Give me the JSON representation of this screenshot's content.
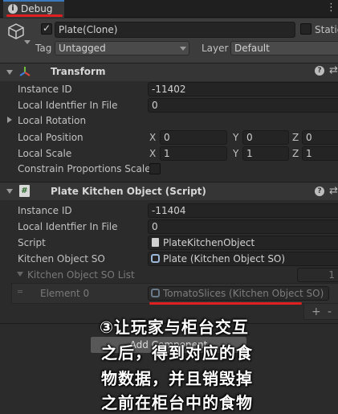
{
  "tab": {
    "label": "Debug"
  },
  "object": {
    "name": "Plate(Clone)",
    "static_label": "Static",
    "tag_label": "Tag",
    "tag_value": "Untagged",
    "layer_label": "Layer",
    "layer_value": "Default"
  },
  "transform": {
    "title": "Transform",
    "instance_id_label": "Instance ID",
    "instance_id": "-11402",
    "local_id_label": "Local Identfier In File",
    "local_id": "0",
    "rotation_label": "Local Rotation",
    "position_label": "Local Position",
    "position": {
      "x": "0",
      "y": "0",
      "z": "0"
    },
    "scale_label": "Local Scale",
    "scale": {
      "x": "1",
      "y": "1",
      "z": "1"
    },
    "axes": {
      "x": "X",
      "y": "Y",
      "z": "Z"
    },
    "constrain_label": "Constrain Proportions Scale"
  },
  "script_component": {
    "title": "Plate Kitchen Object (Script)",
    "instance_id_label": "Instance ID",
    "instance_id": "-11404",
    "local_id_label": "Local Identfier In File",
    "local_id": "0",
    "script_label": "Script",
    "script_value": "PlateKitchenObject",
    "so_label": "Kitchen Object SO",
    "so_value": "Plate (Kitchen Object SO)",
    "list_label": "Kitchen Object SO List",
    "list_count": "1",
    "element_label": "Element 0",
    "element_value": "TomatoSlices (Kitchen Object SO)",
    "add_label": "+",
    "remove_label": "-"
  },
  "add_component_label": "Add Component",
  "overlay": {
    "line1": "③让玩家与柜台交互",
    "line2": "之后，得到对应的食",
    "line3": "物数据，并且销毁掉",
    "line4": "之前在柜台中的食物"
  },
  "colors": {
    "annotation_red": "#e02020",
    "panel": "#2b2b2b",
    "header": "#353535"
  }
}
